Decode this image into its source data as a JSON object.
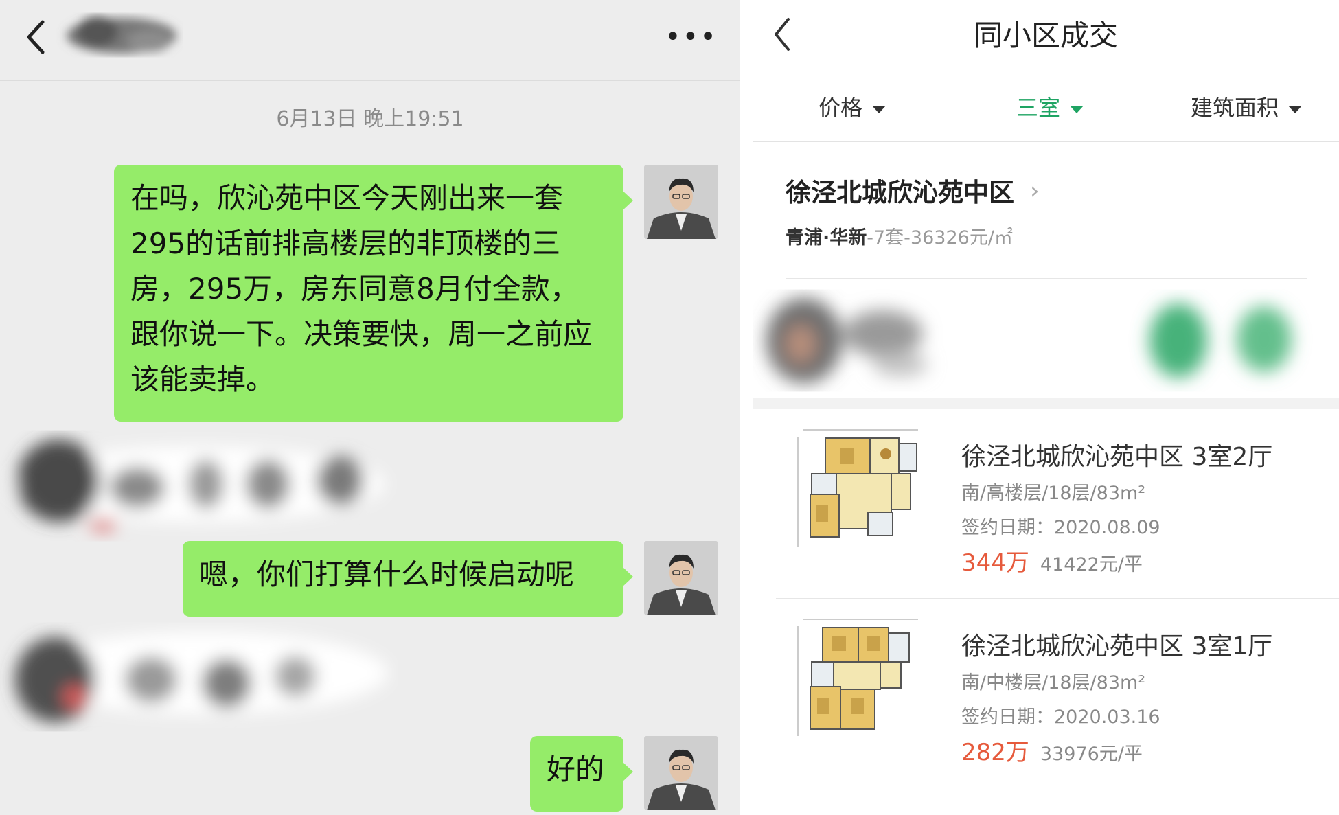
{
  "chat": {
    "header": {
      "back_icon": "chevron-left-icon",
      "more_label": "•••"
    },
    "timestamp": "6月13日 晚上19:51",
    "messages": [
      {
        "text": "在吗，欣沁苑中区今天刚出来一套295的话前排高楼层的非顶楼的三房，295万，房东同意8月付全款，跟你说一下。决策要快，周一之前应该能卖掉。"
      },
      {
        "text": "嗯，你们打算什么时候启动呢"
      },
      {
        "text": "好的"
      }
    ],
    "colors": {
      "bubble": "#95ec69",
      "background": "#ededed"
    }
  },
  "deals": {
    "title": "同小区成交",
    "filters": [
      {
        "label": "价格",
        "active": false
      },
      {
        "label": "三室",
        "active": true
      },
      {
        "label": "建筑面积",
        "active": false
      }
    ],
    "community": {
      "name": "徐泾北城欣沁苑中区",
      "area": "青浦·华新",
      "stats": "-7套-36326元/㎡"
    },
    "listings": [
      {
        "title": "徐泾北城欣沁苑中区 3室2厅",
        "meta": "南/高楼层/18层/83m²",
        "date": "签约日期：2020.08.09",
        "total": "344万",
        "unit_price": "41422元/平"
      },
      {
        "title": "徐泾北城欣沁苑中区 3室1厅",
        "meta": "南/中楼层/18层/83m²",
        "date": "签约日期：2020.03.16",
        "total": "282万",
        "unit_price": "33976元/平"
      }
    ],
    "colors": {
      "accent": "#1fa463",
      "price": "#e65a3c"
    }
  }
}
